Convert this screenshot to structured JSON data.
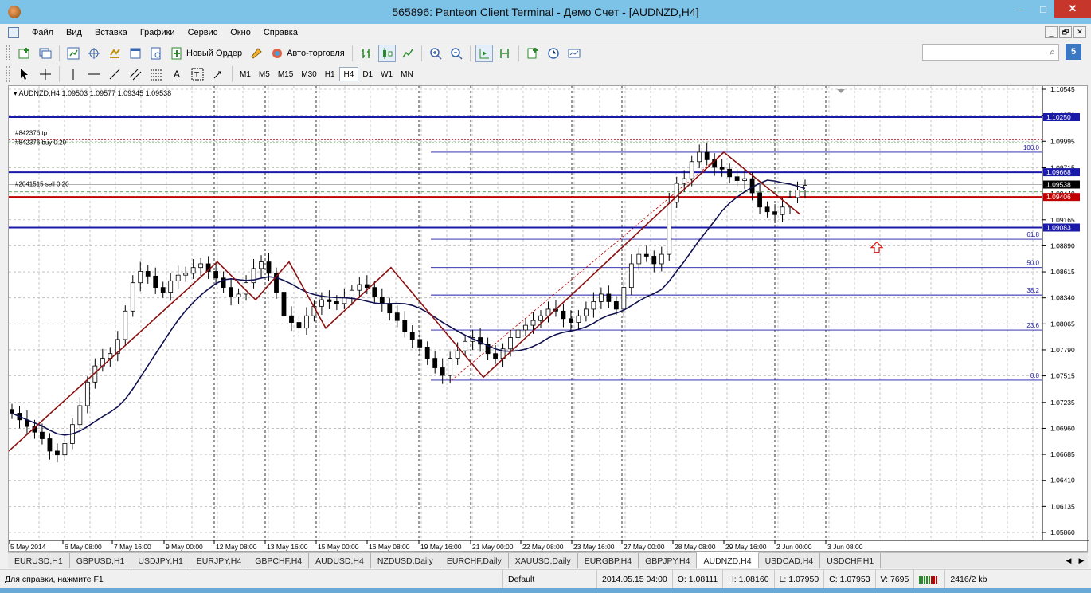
{
  "window": {
    "title": "565896: Panteon Client Terminal - Демо Счет - [AUDNZD,H4]",
    "minimize": "–",
    "maximize": "□",
    "close": "✕"
  },
  "menu": [
    "Файл",
    "Вид",
    "Вставка",
    "Графики",
    "Сервис",
    "Окно",
    "Справка"
  ],
  "mdi": [
    "_",
    "🗗",
    "✕"
  ],
  "toolbar1": {
    "new_order": "Новый Ордер",
    "auto_trading": "Авто-торговля",
    "community": "5"
  },
  "timeframes": [
    "M1",
    "M5",
    "M15",
    "M30",
    "H1",
    "H4",
    "D1",
    "W1",
    "MN"
  ],
  "active_timeframe": "H4",
  "chart": {
    "header": "AUDNZD,H4  1.09503 1.09577 1.09345 1.09538",
    "order_labels": {
      "tp": "#842376 tp",
      "sell": "#2041515 sell 0.20",
      "buy_label": "#842376 buy 0.20"
    },
    "price_scale": [
      "1.10545",
      "1.10270",
      "1.09995",
      "1.09715",
      "1.09440",
      "1.09165",
      "1.08890",
      "1.08615",
      "1.08340",
      "1.08065",
      "1.07790",
      "1.07515",
      "1.07235",
      "1.06960",
      "1.06685",
      "1.06410",
      "1.06135",
      "1.05860"
    ],
    "highlight_prices": {
      "line_top": "1.10250",
      "line_mid": "1.09668",
      "current": "1.09538",
      "red": "1.09406",
      "line_low": "1.09083"
    },
    "fib_levels": [
      "100.0",
      "61.8",
      "50.0",
      "38.2",
      "23.6",
      "0.0"
    ],
    "time_labels": [
      "5 May 2014",
      "6 May 08:00",
      "7 May 16:00",
      "9 May 00:00",
      "12 May 08:00",
      "13 May 16:00",
      "15 May 00:00",
      "16 May 08:00",
      "19 May 16:00",
      "21 May 00:00",
      "22 May 08:00",
      "23 May 16:00",
      "27 May 00:00",
      "28 May 08:00",
      "29 May 16:00",
      "2 Jun 00:00",
      "3 Jun 08:00"
    ],
    "colors": {
      "hline": "#1a1aa8",
      "red_line": "#c00000",
      "fib": "#1a1aa8",
      "ma": "#101050",
      "zigzag": "#8b1010",
      "grid": "#b8b8b8"
    }
  },
  "tabs": [
    "EURUSD,H1",
    "GBPUSD,H1",
    "USDJPY,H1",
    "EURJPY,H4",
    "GBPCHF,H4",
    "AUDUSD,H4",
    "NZDUSD,Daily",
    "EURCHF,Daily",
    "XAUUSD,Daily",
    "EURGBP,H4",
    "GBPJPY,H4",
    "AUDNZD,H4",
    "USDCAD,H4",
    "USDCHF,H1"
  ],
  "active_tab": "AUDNZD,H4",
  "status": {
    "help": "Для справки, нажмите F1",
    "profile": "Default",
    "datetime": "2014.05.15 04:00",
    "open": "O: 1.08111",
    "high": "H: 1.08160",
    "low": "L: 1.07950",
    "close": "C: 1.07953",
    "volume": "V: 7695",
    "traffic": "2416/2 kb"
  }
}
